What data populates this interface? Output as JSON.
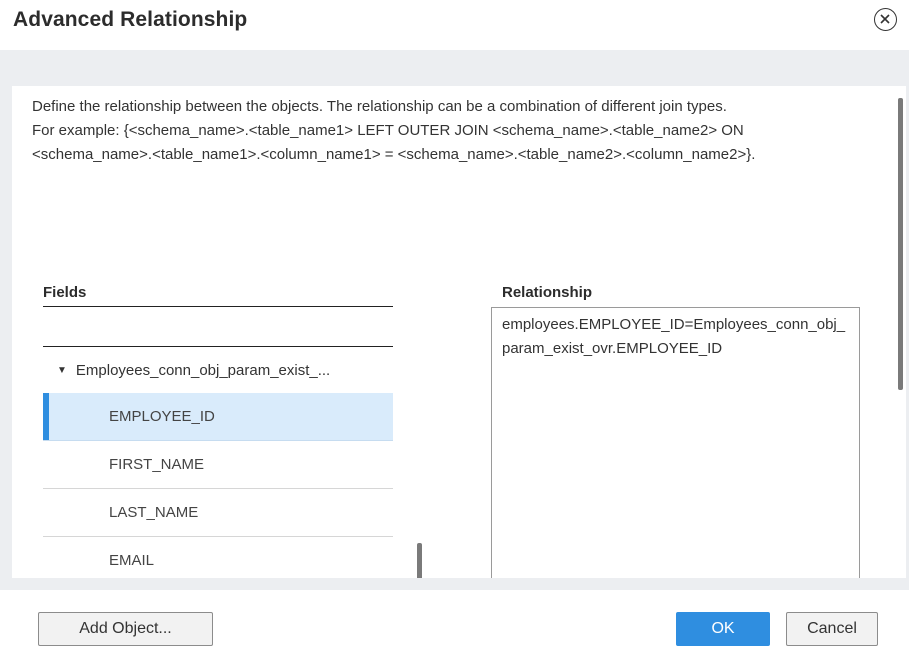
{
  "dialog": {
    "title": "Advanced Relationship",
    "close_icon": "close-circle-icon"
  },
  "description": {
    "line1": "Define the relationship between the objects. The relationship can be a combination of different join types.",
    "line2": "For example: {<schema_name>.<table_name1> LEFT OUTER JOIN <schema_name>.<table_name2> ON <schema_name>.<table_name1>.<column_name1> = <schema_name>.<table_name2>.<column_name2>}."
  },
  "fields": {
    "header": "Fields",
    "parent": "Employees_conn_obj_param_exist_...",
    "items": [
      {
        "label": "EMPLOYEE_ID",
        "selected": true
      },
      {
        "label": "FIRST_NAME",
        "selected": false
      },
      {
        "label": "LAST_NAME",
        "selected": false
      },
      {
        "label": "EMAIL",
        "selected": false
      }
    ]
  },
  "relationship": {
    "header": "Relationship",
    "value": "employees.EMPLOYEE_ID=Employees_conn_obj_param_exist_ovr.EMPLOYEE_ID"
  },
  "buttons": {
    "add_object": "Add Object...",
    "ok": "OK",
    "cancel": "Cancel"
  },
  "colors": {
    "accent": "#2f8ee0",
    "selected_row": "#d9ebfb",
    "backdrop": "#eceef1"
  }
}
